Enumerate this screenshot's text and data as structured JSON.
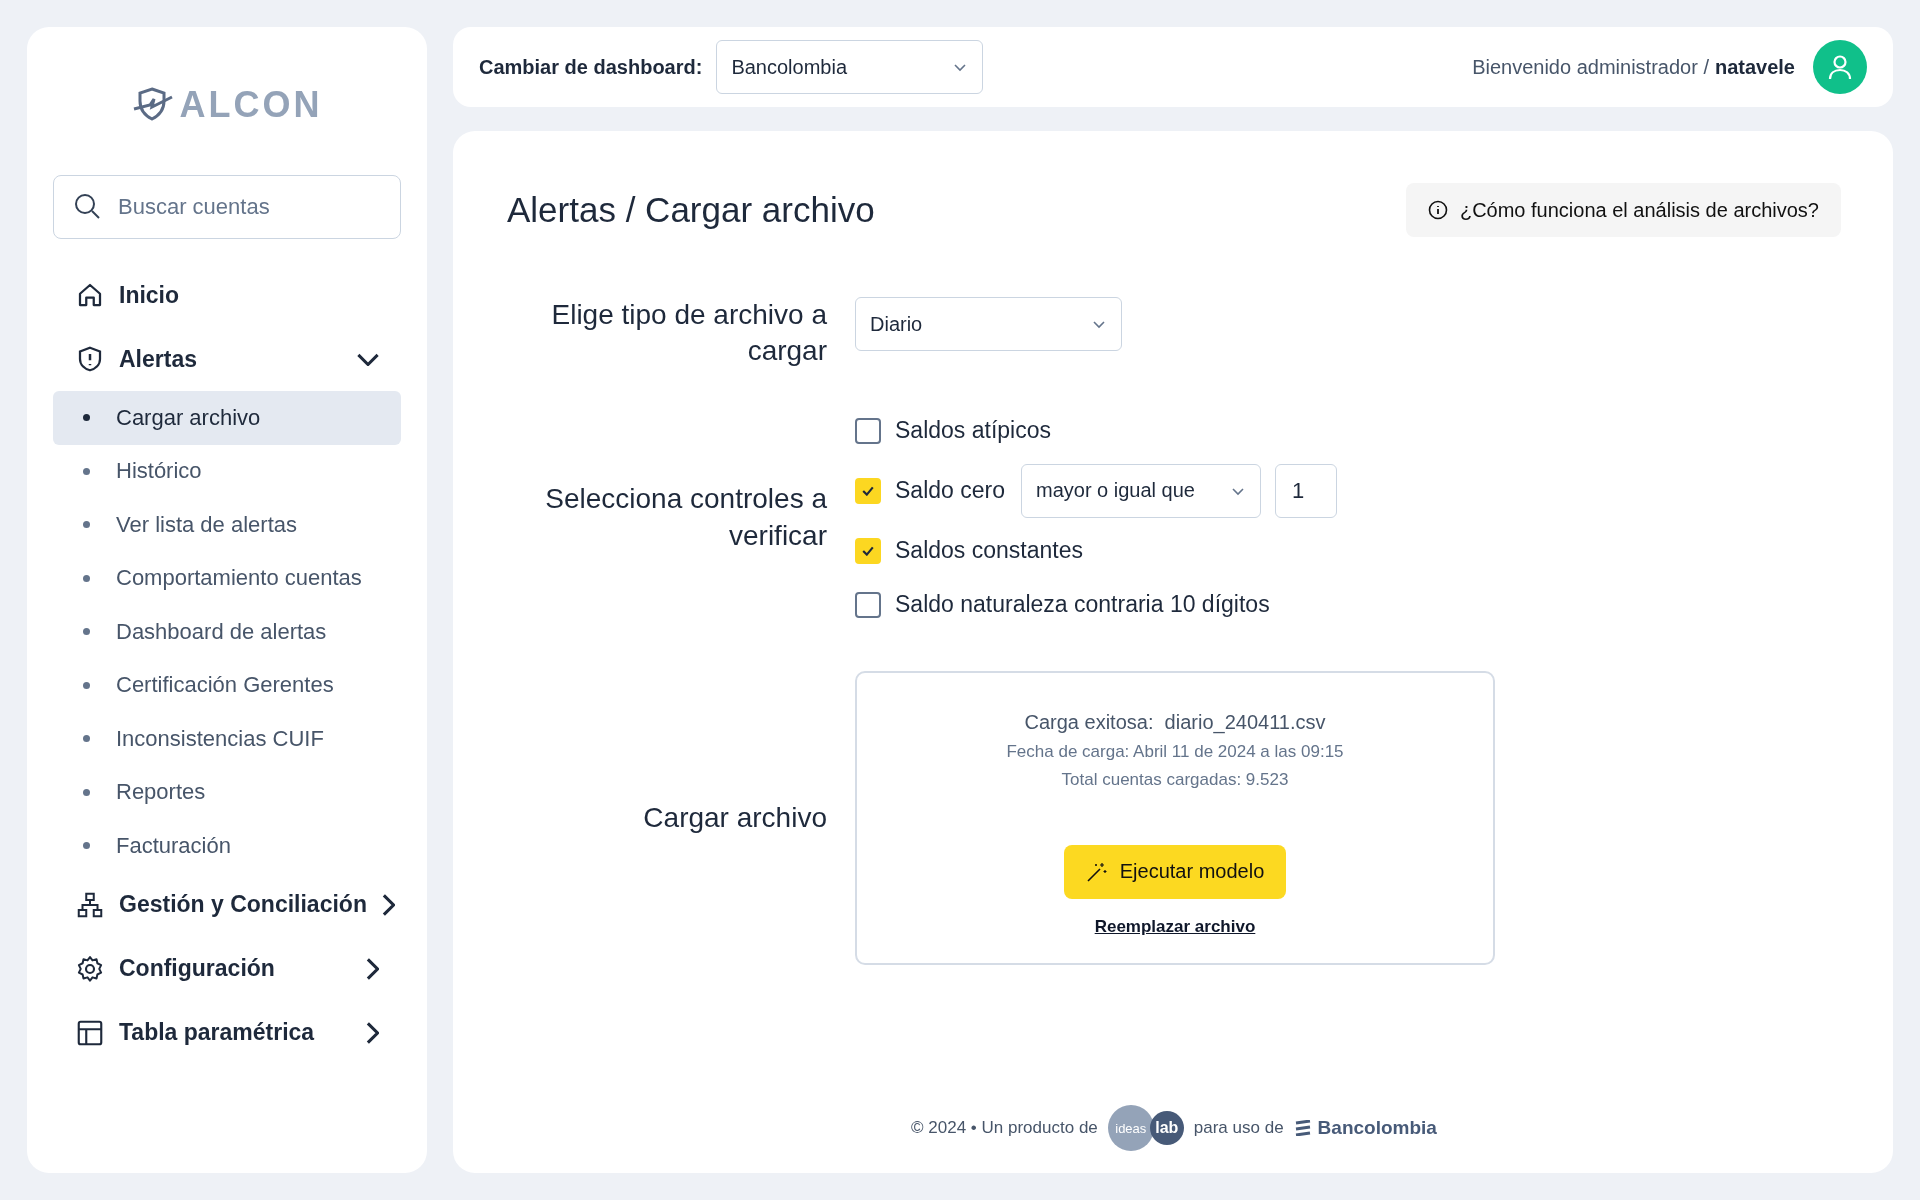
{
  "sidebar": {
    "logo": "ALCON",
    "search": {
      "placeholder": "Buscar cuentas"
    },
    "nav": [
      {
        "label": "Inicio"
      },
      {
        "label": "Alertas",
        "expanded": true,
        "children": [
          {
            "label": "Cargar archivo",
            "selected": true
          },
          {
            "label": "Histórico",
            "selected": false
          },
          {
            "label": "Ver lista de alertas",
            "selected": false
          },
          {
            "label": "Comportamiento cuentas",
            "selected": false
          },
          {
            "label": "Dashboard de alertas",
            "selected": false
          },
          {
            "label": "Certificación Gerentes",
            "selected": false
          },
          {
            "label": "Inconsistencias CUIF",
            "selected": false
          },
          {
            "label": "Reportes",
            "selected": false
          },
          {
            "label": "Facturación",
            "selected": false
          }
        ]
      },
      {
        "label": "Gestión y Conciliación",
        "expanded": false
      },
      {
        "label": "Configuración",
        "expanded": false
      },
      {
        "label": "Tabla paramétrica",
        "expanded": false
      }
    ]
  },
  "topbar": {
    "switch_label": "Cambiar de dashboard:",
    "dashboard": "Bancolombia",
    "welcome": "Bienvenido administrador /",
    "user": "natavele"
  },
  "main": {
    "breadcrumb": "Alertas / Cargar archivo",
    "help_button": "¿Cómo funciona el análisis de archivos?",
    "file_type": {
      "label": "Elige tipo de archivo a cargar",
      "value": "Diario"
    },
    "controls": {
      "label": "Selecciona controles a verificar",
      "items": [
        {
          "kind": "plain",
          "label": "Saldos atípicos",
          "checked": false
        },
        {
          "kind": "condition",
          "label": "Saldo cero",
          "checked": true,
          "operator": "mayor o igual que",
          "value": "1"
        },
        {
          "kind": "plain",
          "label": "Saldos constantes",
          "checked": true
        },
        {
          "kind": "plain",
          "label": "Saldo naturaleza contraria 10 dígitos",
          "checked": false
        }
      ]
    },
    "upload": {
      "label": "Cargar archivo",
      "status": "Carga exitosa:",
      "filename": "diario_240411.csv",
      "date": "Fecha de carga: Abril 11 de 2024 a las 09:15",
      "total": "Total cuentas cargadas: 9.523",
      "run_button": "Ejecutar modelo",
      "replace_link": "Reemplazar archivo"
    },
    "footer": {
      "copyright": "© 2024 • Un producto de",
      "maker_logo_a": "ideas",
      "maker_logo_b": "lab",
      "for_use": "para uso de",
      "client_logo": "Bancolombia"
    }
  }
}
